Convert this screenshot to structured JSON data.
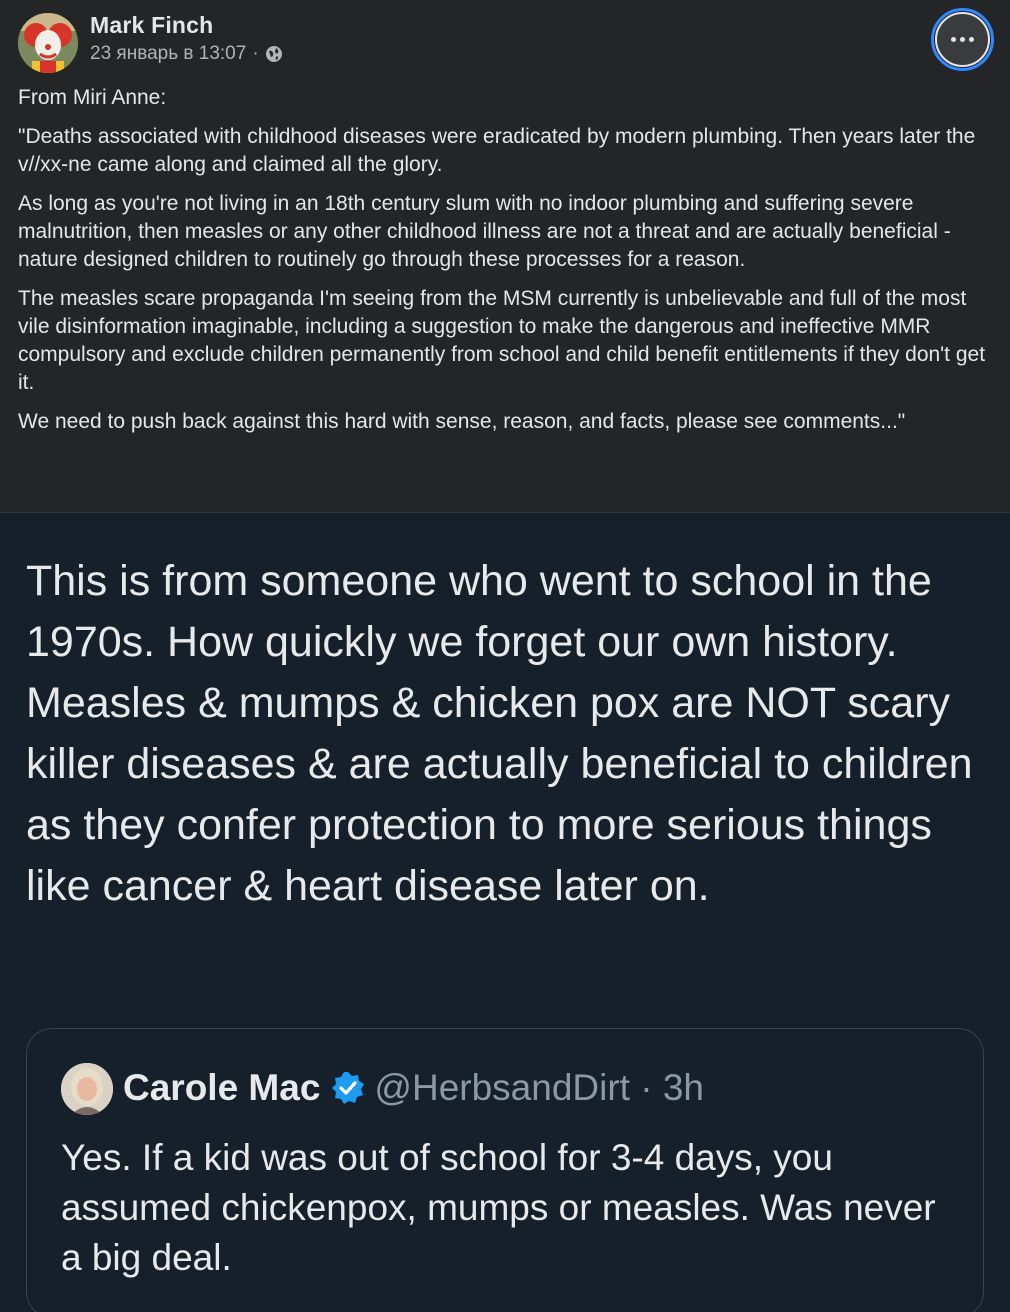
{
  "post": {
    "author": "Mark Finch",
    "date": "23 январь в 13:07",
    "meta_separator": "·",
    "paragraphs": [
      "From Miri Anne:",
      "\"Deaths associated with childhood diseases were eradicated by modern plumbing. Then years later the v//xx-ne came along and claimed all the glory.",
      "As long as you're not living in an 18th century slum with no indoor plumbing and suffering severe malnutrition, then measles or any other childhood illness are not a threat and are actually beneficial - nature designed children to routinely go through these processes for a reason.",
      "The measles scare propaganda I'm seeing from the MSM currently is unbelievable and full of the most vile disinformation imaginable, including a suggestion to make the dangerous and ineffective MMR compulsory and exclude children permanently from school and child benefit entitlements if they don't get it.",
      "We need to push back against this hard with sense, reason, and facts, please see comments...\""
    ]
  },
  "tweet": {
    "text": "This is from someone who went to school in the 1970s. How quickly we forget our own history. Measles & mumps & chicken pox are NOT scary killer diseases & are actually beneficial to children as they confer protection to more serious things like cancer & heart disease later on.",
    "quote": {
      "name": "Carole Mac",
      "handle_time": "@HerbsandDirt · 3h",
      "text": "Yes. If a kid was out of school for 3-4 days, you assumed chickenpox, mumps or measles. Was never a big deal."
    }
  },
  "icons": {
    "globe": "globe-icon",
    "more": "more-options-icon",
    "verified": "verified-badge-icon"
  },
  "colors": {
    "post_bg": "#242526",
    "tweet_bg": "#15202b",
    "accent": "#2d88ff",
    "verified": "#1d9bf0"
  }
}
